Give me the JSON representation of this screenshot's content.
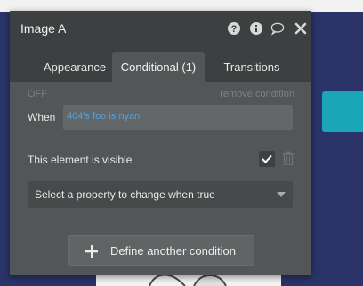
{
  "panel": {
    "title": "Image A",
    "icons": [
      "help-icon",
      "info-icon",
      "comment-icon",
      "close-icon"
    ]
  },
  "tabs": [
    {
      "label": "Appearance",
      "active": false
    },
    {
      "label": "Conditional (1)",
      "active": true
    },
    {
      "label": "Transitions",
      "active": false
    }
  ],
  "condition": {
    "state_label": "OFF",
    "remove_label": "remove condition",
    "when_label": "When",
    "expression": "404's foo is nyan",
    "property_label": "This element is visible",
    "property_checked": true,
    "select_placeholder": "Select a property to change when true"
  },
  "footer": {
    "define_label": "Define another condition"
  },
  "colors": {
    "expression": "#4fa3e0",
    "panel_bg": "#535657",
    "header_bg": "#3d4040",
    "page_bg": "#2a3468",
    "accent_block": "#1aa6b7"
  }
}
